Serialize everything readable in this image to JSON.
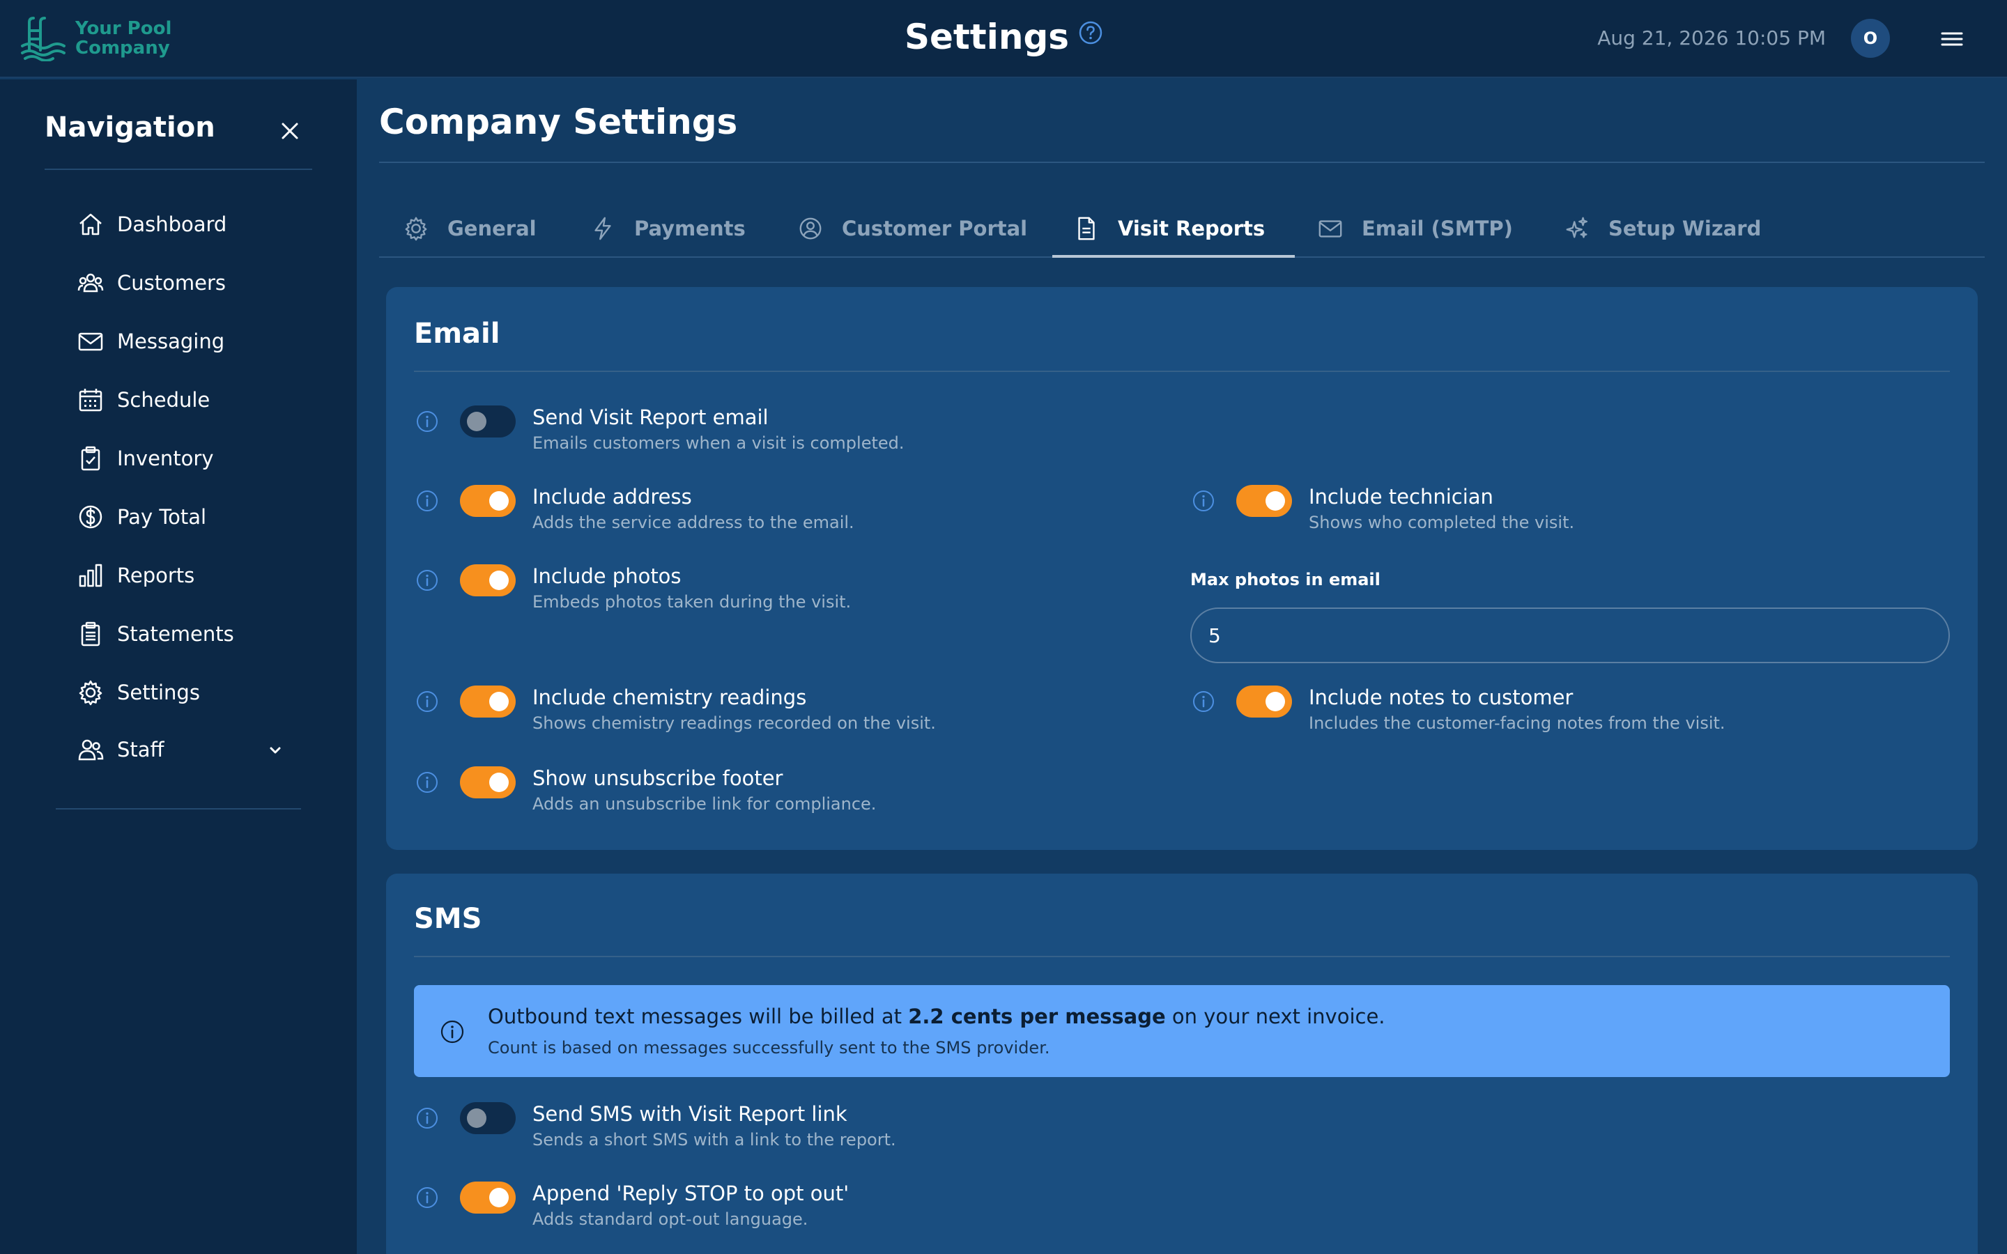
{
  "header": {
    "logo_line1": "Your Pool",
    "logo_line2": "Company",
    "title": "Settings",
    "datetime": "Aug 21, 2026 10:05 PM",
    "avatar_initial": "O"
  },
  "sidebar": {
    "title": "Navigation",
    "items": [
      {
        "label": "Dashboard",
        "icon": "home-icon"
      },
      {
        "label": "Customers",
        "icon": "users-icon"
      },
      {
        "label": "Messaging",
        "icon": "mail-icon"
      },
      {
        "label": "Schedule",
        "icon": "calendar-icon"
      },
      {
        "label": "Inventory",
        "icon": "clipboard-check-icon"
      },
      {
        "label": "Pay Total",
        "icon": "dollar-icon"
      },
      {
        "label": "Reports",
        "icon": "bar-chart-icon"
      },
      {
        "label": "Statements",
        "icon": "document-list-icon"
      },
      {
        "label": "Settings",
        "icon": "gear-icon"
      },
      {
        "label": "Staff",
        "icon": "staff-icon"
      }
    ]
  },
  "main": {
    "title": "Company Settings",
    "tabs": [
      {
        "label": "General",
        "icon": "gear-icon"
      },
      {
        "label": "Payments",
        "icon": "lightning-icon"
      },
      {
        "label": "Customer Portal",
        "icon": "user-circle-icon"
      },
      {
        "label": "Visit Reports",
        "icon": "document-icon",
        "active": true
      },
      {
        "label": "Email (SMTP)",
        "icon": "envelope-icon"
      },
      {
        "label": "Setup Wizard",
        "icon": "sparkles-icon"
      }
    ],
    "email": {
      "title": "Email",
      "send_report": {
        "label": "Send Visit Report email",
        "desc": "Emails customers when a visit is completed.",
        "on": false
      },
      "include_address": {
        "label": "Include address",
        "desc": "Adds the service address to the email.",
        "on": true
      },
      "include_technician": {
        "label": "Include technician",
        "desc": "Shows who completed the visit.",
        "on": true
      },
      "include_photos": {
        "label": "Include photos",
        "desc": "Embeds photos taken during the visit.",
        "on": true
      },
      "max_photos_label": "Max photos in email",
      "max_photos_value": "5",
      "include_chemistry": {
        "label": "Include chemistry readings",
        "desc": "Shows chemistry readings recorded on the visit.",
        "on": true
      },
      "include_notes": {
        "label": "Include notes to customer",
        "desc": "Includes the customer-facing notes from the visit.",
        "on": true
      },
      "unsubscribe_footer": {
        "label": "Show unsubscribe footer",
        "desc": "Adds an unsubscribe link for compliance.",
        "on": true
      }
    },
    "sms": {
      "title": "SMS",
      "notice_pre": "Outbound text messages will be billed at ",
      "notice_bold": "2.2 cents per message",
      "notice_post": " on your next invoice.",
      "notice_sub": "Count is based on messages successfully sent to the SMS provider.",
      "send_sms": {
        "label": "Send SMS with Visit Report link",
        "desc": "Sends a short SMS with a link to the report.",
        "on": false
      },
      "append_stop": {
        "label": "Append 'Reply STOP to opt out'",
        "desc": "Adds standard opt-out language.",
        "on": true
      }
    }
  },
  "colors": {
    "accent_orange": "#f7901e",
    "notice_blue": "#60a5fa",
    "card_bg": "#1a4e80",
    "sidebar_bg": "#0c2846"
  }
}
